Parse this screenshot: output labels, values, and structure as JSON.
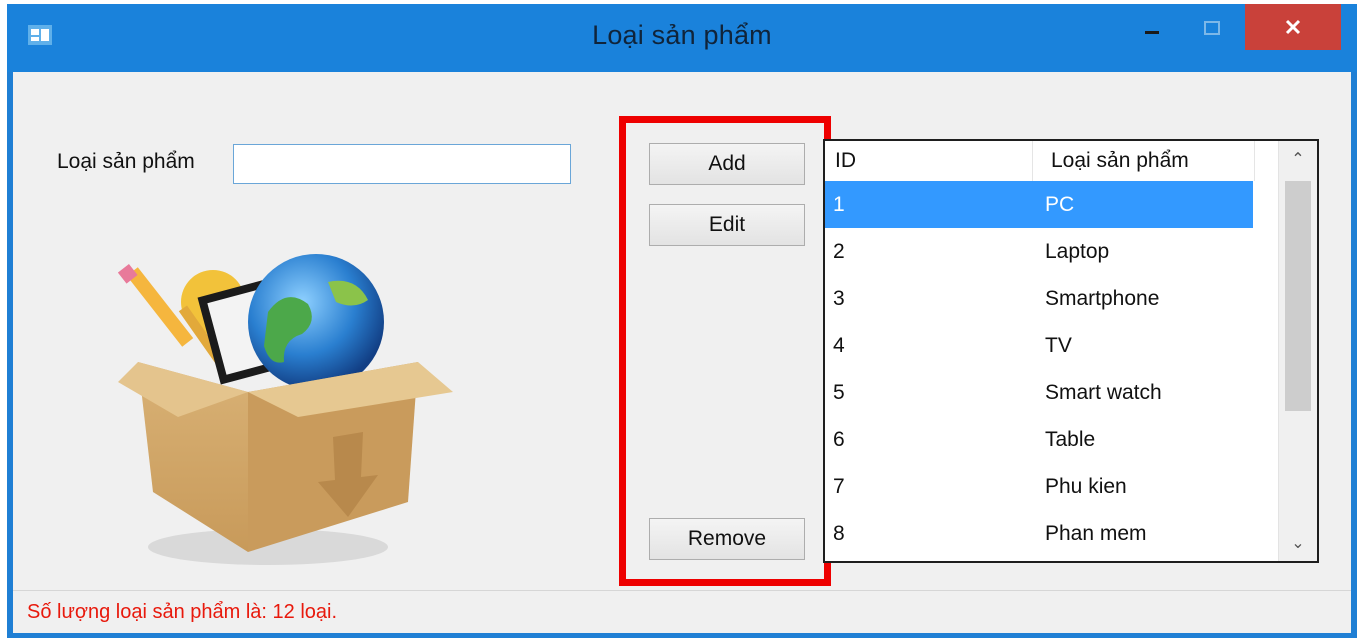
{
  "window": {
    "title": "Loại sản phẩm",
    "controls": {
      "minimize": "–",
      "maximize": "☐",
      "close": "✕"
    }
  },
  "form": {
    "label": "Loại sản phẩm",
    "input_value": "",
    "input_placeholder": ""
  },
  "buttons": {
    "add": "Add",
    "edit": "Edit",
    "remove": "Remove"
  },
  "list": {
    "columns": [
      "ID",
      "Loại sản phẩm"
    ],
    "rows": [
      {
        "id": "1",
        "name": "PC",
        "selected": true
      },
      {
        "id": "2",
        "name": "Laptop"
      },
      {
        "id": "3",
        "name": "Smartphone"
      },
      {
        "id": "4",
        "name": "TV"
      },
      {
        "id": "5",
        "name": "Smart watch"
      },
      {
        "id": "6",
        "name": "Table"
      },
      {
        "id": "7",
        "name": "Phu kien"
      },
      {
        "id": "8",
        "name": "Phan mem"
      }
    ],
    "scroll": {
      "up": "⌃",
      "down": "⌄"
    }
  },
  "status": {
    "text": "Số lượng loại sản phẩm là: 12 loại."
  },
  "colors": {
    "titlebar": "#1a82db",
    "selection": "#3399ff",
    "highlight": "#ee0000",
    "status_text": "#e8190c",
    "close_button": "#c9413a"
  },
  "icons": {
    "app": "app-icon",
    "picture": "product-box-image"
  }
}
